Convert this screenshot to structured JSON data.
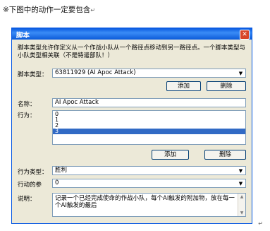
{
  "page_heading": "※下图中的动作一定要包含",
  "return_glyph": "↵",
  "dialog": {
    "title": "脚本",
    "close_glyph": "✕",
    "description": "脚本类型允许你定义从一个作战小队从一个路径点移动到另一路径点。一个脚本类型与小队类型相关联（不是特遣部队！）",
    "script_type": {
      "label": "脚本类型：",
      "value": "63811929 (AI Apoc Attack)",
      "arrow": "▼"
    },
    "add_button_1": "添加",
    "delete_button_1": "删除",
    "name": {
      "label": "名称：",
      "value": "AI Apoc Attack"
    },
    "actions": {
      "label": "行为：",
      "items": [
        "0",
        "1",
        "2",
        "3"
      ],
      "selected_index": 3
    },
    "add_button_2": "添加",
    "delete_button_2": "删除",
    "action_type": {
      "label": "行为类型：",
      "value": "胜利",
      "arrow": "▼"
    },
    "action_param": {
      "label": "行动的参",
      "value": "0",
      "arrow": "▼"
    },
    "note": {
      "label": "说明：",
      "text": "记录一个已经完成使命的作战小队，每个AI触发的附加物，放在每一个AI触发的最后",
      "scroll_up": "▲",
      "scroll_down": "▼"
    }
  }
}
